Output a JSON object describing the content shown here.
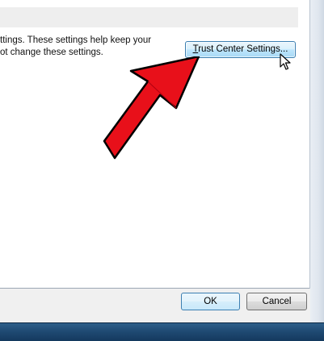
{
  "dialog": {
    "description_line1": "ttings. These settings help keep your",
    "description_line2": "ot change these settings.",
    "trust_center_button": {
      "mnemonic": "T",
      "rest": "rust Center Settings..."
    },
    "ok_label": "OK",
    "cancel_label": "Cancel"
  },
  "annotation": {
    "arrow_color": "#e8101a",
    "arrow_outline": "#000000"
  },
  "icons": {
    "cursor": "mouse-pointer-icon",
    "arrow": "red-arrow-annotation"
  }
}
